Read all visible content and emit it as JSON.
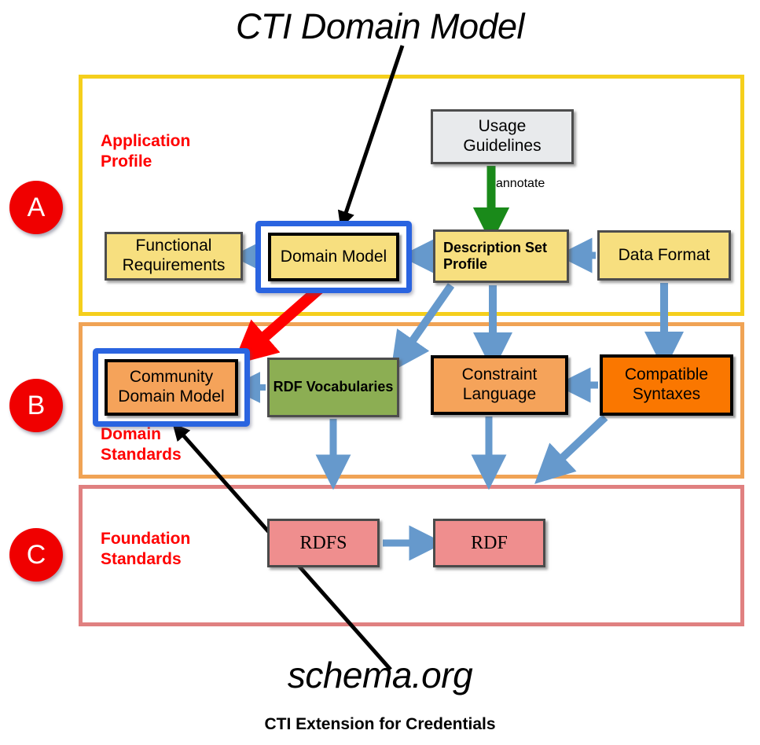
{
  "diagram": {
    "top_title": "CTI Domain Model",
    "bottom_title": "schema.org",
    "caption": "CTI Extension for Credentials",
    "colors": {
      "accent_red": "#ff0000",
      "highlight_blue": "#2a64e0",
      "arrow_blue": "#6699cc",
      "arrow_green": "#1a8a1a",
      "arrow_red": "#ff0000",
      "section_a_border": "#f5cf1c",
      "section_b_border": "#f0a355",
      "section_c_border": "#e08080",
      "fill_yellow": "#f7df7f",
      "fill_grey": "#e8eaec",
      "fill_green": "#8cae53",
      "fill_orange_light": "#f5a35a",
      "fill_orange_dark": "#fa7700",
      "fill_pink": "#ef8e8e",
      "badge_red": "#f00000"
    },
    "sections": [
      {
        "badge": "A",
        "label": "Application\nProfile"
      },
      {
        "badge": "B",
        "label": "Domain\nStandards"
      },
      {
        "badge": "C",
        "label": "Foundation\nStandards"
      }
    ],
    "nodes": {
      "functional_requirements": "Functional\nRequirements",
      "domain_model": "Domain Model",
      "usage_guidelines": "Usage\nGuidelines",
      "description_set_profile": "Description Set\nProfile",
      "data_format": "Data Format",
      "community_domain_model": "Community\nDomain Model",
      "rdf_vocabularies": "RDF Vocabularies",
      "constraint_language": "Constraint\nLanguage",
      "compatible_syntaxes": "Compatible\nSyntaxes",
      "rdfs": "RDFS",
      "rdf": "RDF"
    },
    "edges": {
      "annotate_label": "annotate"
    }
  }
}
